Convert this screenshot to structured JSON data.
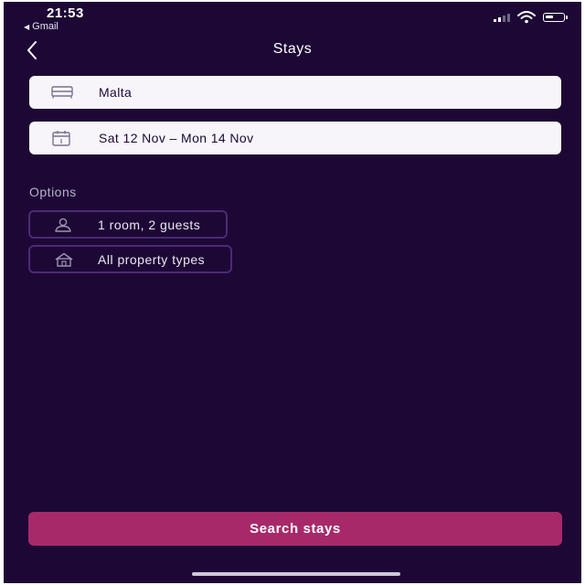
{
  "status_bar": {
    "time": "21:53",
    "back_app": "Gmail",
    "icons": [
      "signal-icon",
      "wifi-icon",
      "battery-icon"
    ]
  },
  "header": {
    "title": "Stays",
    "back_icon": "chevron-left-icon"
  },
  "search": {
    "destination": {
      "value": "Malta",
      "icon": "bed-icon"
    },
    "dates": {
      "value": "Sat 12 Nov – Mon 14 Nov",
      "icon": "calendar-icon"
    }
  },
  "options": {
    "label": "Options",
    "guests": {
      "value": "1 room, 2 guests",
      "icon": "person-icon"
    },
    "property": {
      "value": "All property types",
      "icon": "house-icon"
    }
  },
  "actions": {
    "search_label": "Search stays"
  },
  "colors": {
    "background": "#1d0835",
    "field": "#f7f5fa",
    "chip_border": "#4a2a78",
    "accent": "#a8296a"
  }
}
